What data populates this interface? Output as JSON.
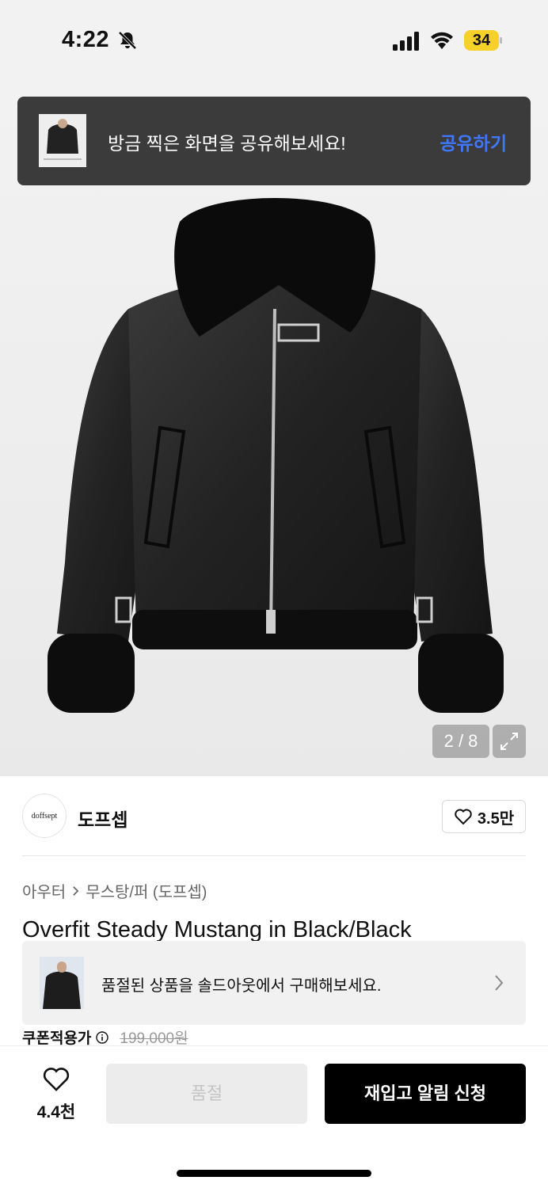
{
  "status_bar": {
    "time": "4:22",
    "battery": "34"
  },
  "toast": {
    "message": "방금 찍은 화면을 공유해보세요!",
    "action": "공유하기"
  },
  "gallery": {
    "pager": "2 / 8"
  },
  "brand": {
    "logo_text": "doffsept",
    "name": "도프셉",
    "likes": "3.5만"
  },
  "breadcrumb": {
    "category": "아우터",
    "subcategory": "무스탕/퍼 (도프셉)"
  },
  "product": {
    "title": "Overfit Steady Mustang in Black/Black"
  },
  "soldout_banner": {
    "message": "품절된 상품을 솔드아웃에서 구매해보세요."
  },
  "price": {
    "label": "쿠폰적용가",
    "original": "199,000원"
  },
  "bottom_bar": {
    "wish_count": "4.4천",
    "soldout_label": "품절",
    "restock_label": "재입고 알림 신청"
  },
  "colors": {
    "accent_blue": "#3f78ff",
    "battery_yellow": "#f6d12a"
  }
}
